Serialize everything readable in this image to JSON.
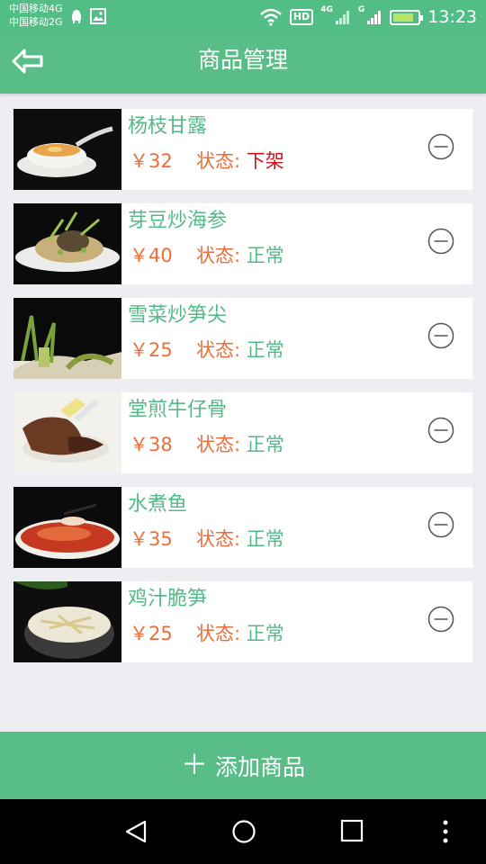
{
  "status_bar": {
    "carrier_1": "中国移动4G",
    "carrier_2": "中国移动2G",
    "hd": "HD",
    "net_1": "4G",
    "net_2": "G",
    "time": "13:23"
  },
  "header": {
    "title": "商品管理",
    "back_icon": "back-arrow-icon"
  },
  "status_label": "状态:",
  "products": [
    {
      "name": "杨枝甘露",
      "price": "￥32",
      "status": "下架",
      "status_color": "#d0121b"
    },
    {
      "name": "芽豆炒海参",
      "price": "￥40",
      "status": "正常",
      "status_color": "#53b987"
    },
    {
      "name": "雪菜炒笋尖",
      "price": "￥25",
      "status": "正常",
      "status_color": "#53b987"
    },
    {
      "name": "堂煎牛仔骨",
      "price": "￥38",
      "status": "正常",
      "status_color": "#53b987"
    },
    {
      "name": "水煮鱼",
      "price": "￥35",
      "status": "正常",
      "status_color": "#53b987"
    },
    {
      "name": "鸡汁脆笋",
      "price": "￥25",
      "status": "正常",
      "status_color": "#53b987"
    }
  ],
  "add_button": {
    "icon": "plus-icon",
    "label": "添加商品"
  },
  "colors": {
    "primary": "#58bd87",
    "name_green": "#53b987",
    "price_orange": "#ea6e3a",
    "offline_red": "#d0121b",
    "background": "#eeeef2"
  }
}
